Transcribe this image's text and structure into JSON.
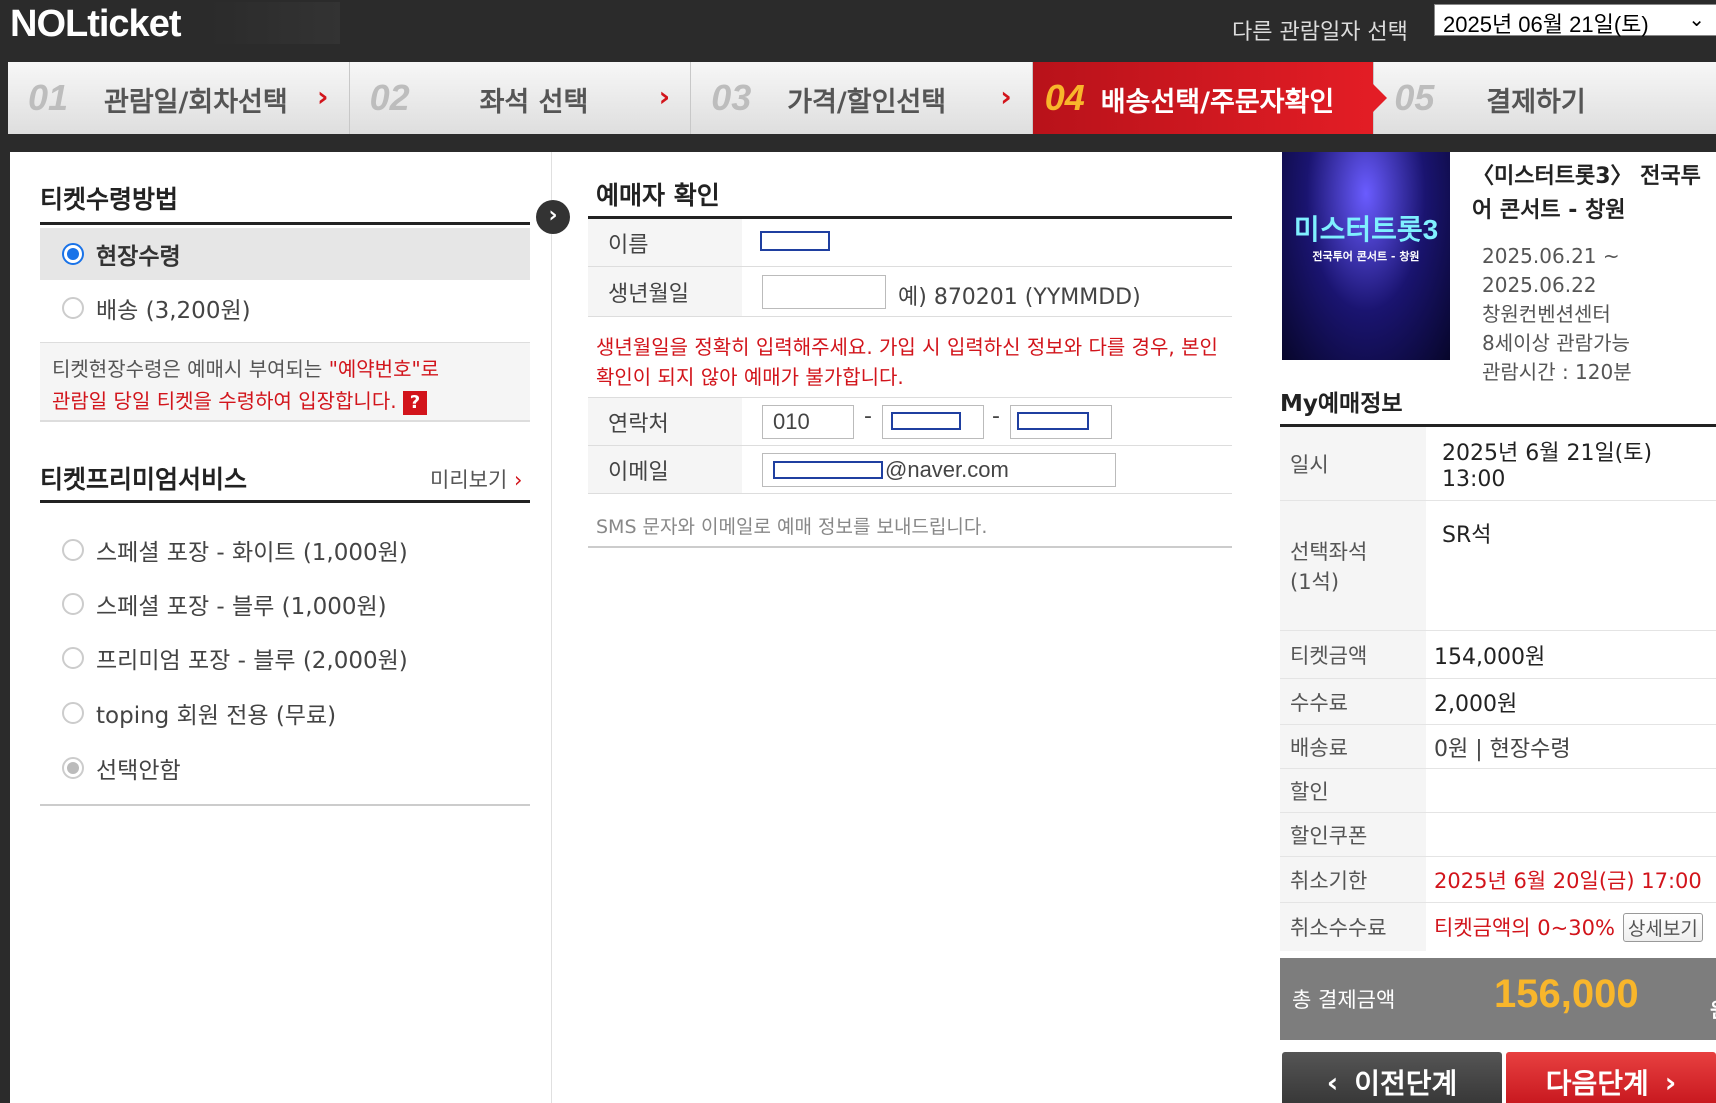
{
  "header": {
    "logo": "NOLticket",
    "date_label": "다른 관람일자 선택",
    "date_value": "2025년 06월 21일(토)"
  },
  "steps": [
    {
      "num": "01",
      "label": "관람일/회차선택"
    },
    {
      "num": "02",
      "label": "좌석 선택"
    },
    {
      "num": "03",
      "label": "가격/할인선택"
    },
    {
      "num": "04",
      "label": "배송선택/주문자확인"
    },
    {
      "num": "05",
      "label": "결제하기"
    }
  ],
  "receipt": {
    "title": "티켓수령방법",
    "options": [
      "현장수령",
      "배송 (3,200원)"
    ],
    "selected": "현장수령",
    "notice_line1_a": "티켓현장수령은 예매시 부여되는 ",
    "notice_line1_b": "\"예약번호\"로",
    "notice_line2": "관람일 당일 티켓을 수령하여 입장합니다.",
    "help_icon": "?"
  },
  "premium": {
    "title": "티켓프리미엄서비스",
    "preview_label": "미리보기",
    "options": [
      "스페셜 포장 - 화이트 (1,000원)",
      "스페셜 포장 - 블루 (1,000원)",
      "프리미엄 포장 - 블루 (2,000원)",
      "toping 회원 전용 (무료)",
      "선택안함"
    ],
    "selected": "선택안함"
  },
  "buyer": {
    "title": "예매자 확인",
    "name_label": "이름",
    "birth_label": "생년월일",
    "birth_hint": "예) 870201 (YYMMDD)",
    "warning": "생년월일을 정확히 입력해주세요. 가입 시 입력하신 정보와 다를 경우, 본인확인이 되지 않아 예매가 불가합니다.",
    "contact_label": "연락처",
    "contact_prefix": "010",
    "email_label": "이메일",
    "email_domain": "@naver.com",
    "sms_note": "SMS 문자와 이메일로 예매 정보를 보내드립니다."
  },
  "show": {
    "poster_title": "미스터트롯3",
    "poster_sub": "전국투어 콘서트 - 창원",
    "title": "〈미스터트롯3〉 전국투어 콘서트 - 창원",
    "period_start": "2025.06.21 ~",
    "period_end": "2025.06.22",
    "venue": "창원컨벤션센터",
    "age": "8세이상 관람가능",
    "runtime": "관람시간 : 120분"
  },
  "my_booking": {
    "title": "My예매정보",
    "rows": {
      "datetime_k": "일시",
      "datetime_v1": "2025년 6월 21일(토)",
      "datetime_v2": "13:00",
      "seat_k1": "선택좌석",
      "seat_k2": "(1석)",
      "seat_v": "SR석",
      "price_k": "티켓금액",
      "price_v": "154,000원",
      "fee_k": "수수료",
      "fee_v": "2,000원",
      "delivery_k": "배송료",
      "delivery_v": "0원 | 현장수령",
      "discount_k": "할인",
      "discount_v": "",
      "coupon_k": "할인쿠폰",
      "coupon_v": "",
      "cancel_k": "취소기한",
      "cancel_v": "2025년 6월 20일(금) 17:00",
      "cancelfee_k": "취소수수료",
      "cancelfee_v": "티켓금액의 0~30%",
      "detail_btn": "상세보기"
    },
    "total_label": "총 결제금액",
    "total_value": "156,000",
    "total_unit": "원",
    "prev_btn": "이전단계",
    "next_btn": "다음단계"
  }
}
